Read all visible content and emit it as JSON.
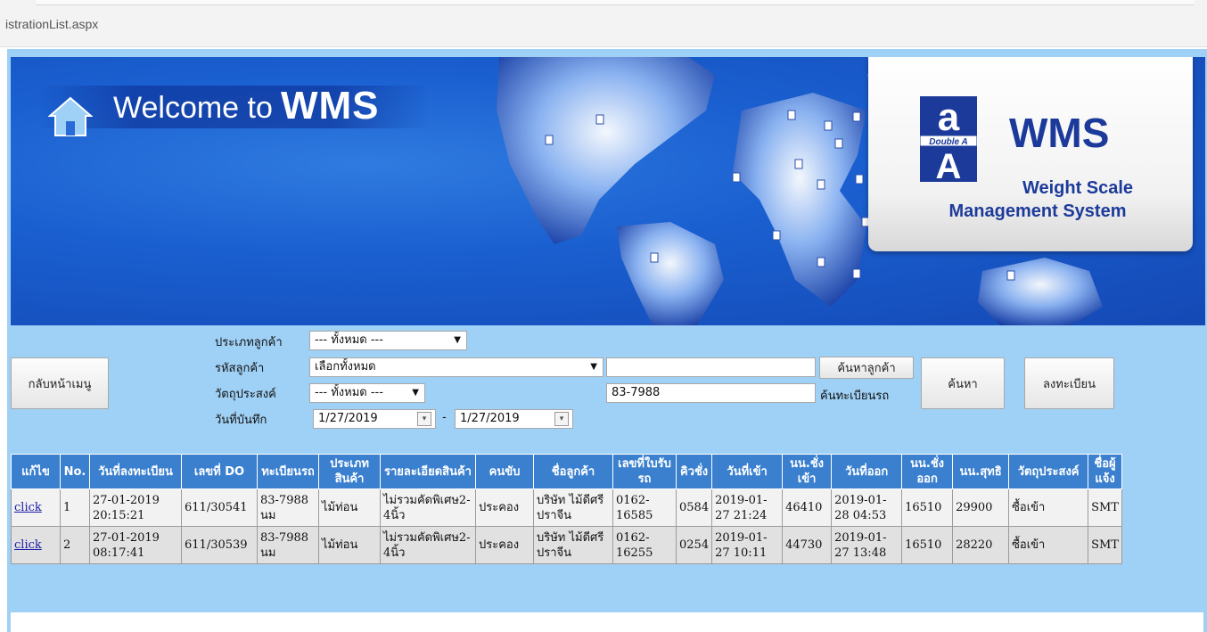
{
  "browser": {
    "url_fragment": "istrationList.aspx"
  },
  "banner": {
    "welcome_text": "Welcome to",
    "welcome_brand": "WMS",
    "logo_badge": "Double A",
    "logo_title": "WMS",
    "logo_subtitle_line1": "Weight Scale",
    "logo_subtitle_line2": "Management System"
  },
  "filters": {
    "back_button": "กลับหน้าเมนู",
    "customer_type_label": "ประเภทลูกค้า",
    "customer_type_value": "--- ทั้งหมด ---",
    "customer_code_label": "รหัสลูกค้า",
    "customer_code_value": "เลือกทั้งหมด",
    "customer_search_value": "",
    "customer_search_button": "ค้นหาลูกค้า",
    "purpose_label": "วัตถุประสงค์",
    "purpose_value": "--- ทั้งหมด ---",
    "plate_value": "83-7988",
    "plate_search_label": "ค้นทะเบียนรถ",
    "date_label": "วันที่บันทึก",
    "date_from": "1/27/2019",
    "date_separator": "-",
    "date_to": "1/27/2019",
    "search_button": "ค้นหา",
    "register_button": "ลงทะเบียน"
  },
  "table": {
    "headers": [
      "แก้ไข",
      "No.",
      "วันที่ลงทะเบียน",
      "เลขที่ DO",
      "ทะเบียนรถ",
      "ประเภทสินค้า",
      "รายละเอียดสินค้า",
      "คนขับ",
      "ชื่อลูกค้า",
      "เลขที่ใบรับรถ",
      "คิวชั่ง",
      "วันที่เข้า",
      "นน.ชั่งเข้า",
      "วันที่ออก",
      "นน.ชั่งออก",
      "นน.สุทธิ",
      "วัตถุประสงค์",
      "ชื่อผู้แจ้ง"
    ],
    "rows": [
      {
        "edit": "click",
        "no": "1",
        "reg_date": "27-01-2019 20:15:21",
        "do_no": "611/30541",
        "plate": "83-7988 นม",
        "product_type": "ไม้ท่อน",
        "product_detail": "ไม่รวมคัดพิเศษ2-4นิ้ว",
        "driver": "ประคอง",
        "customer": "บริษัท ไม้ดีศรีปราจีน",
        "receipt_no": "0162-16585",
        "queue": "0584",
        "in_date": "2019-01-27 21:24",
        "weight_in": "46410",
        "out_date": "2019-01-28 04:53",
        "weight_out": "16510",
        "net_weight": "29900",
        "purpose": "ซื้อเข้า",
        "informer": "SMT"
      },
      {
        "edit": "click",
        "no": "2",
        "reg_date": "27-01-2019 08:17:41",
        "do_no": "611/30539",
        "plate": "83-7988 นม",
        "product_type": "ไม้ท่อน",
        "product_detail": "ไม่รวมคัดพิเศษ2-4นิ้ว",
        "driver": "ประคอง",
        "customer": "บริษัท ไม้ดีศรีปราจีน",
        "receipt_no": "0162-16255",
        "queue": "0254",
        "in_date": "2019-01-27 10:11",
        "weight_in": "44730",
        "out_date": "2019-01-27 13:48",
        "weight_out": "16510",
        "net_weight": "28220",
        "purpose": "ซื้อเข้า",
        "informer": "SMT"
      }
    ]
  },
  "colors": {
    "banner_blue": "#1a5fd0",
    "page_background": "#9fd0f5",
    "table_header": "#3b80cf",
    "logo_text": "#1c3a9a"
  }
}
